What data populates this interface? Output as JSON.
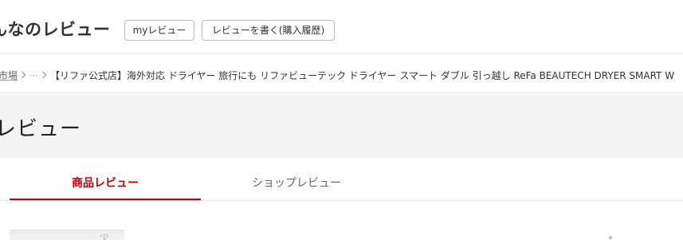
{
  "header": {
    "site_title": "んなのレビュー",
    "my_review_button": "myレビュー",
    "write_review_button": "レビューを書く(購入履歴)"
  },
  "breadcrumb": {
    "root": "市場",
    "ellipsis": "⋯",
    "current": "【リファ公式店】海外対応 ドライヤー 旅行にも リファビューテック ドライヤー スマート ダブル 引っ越し ReFa BEAUTECH DRYER SMART W"
  },
  "banner": {
    "title": "レビュー"
  },
  "tabs": [
    {
      "label": "商品レビュー",
      "active": true
    },
    {
      "label": "ショップレビュー",
      "active": false
    }
  ],
  "colors": {
    "accent": "#bf0000",
    "banner_bg": "#f4f4f4"
  }
}
